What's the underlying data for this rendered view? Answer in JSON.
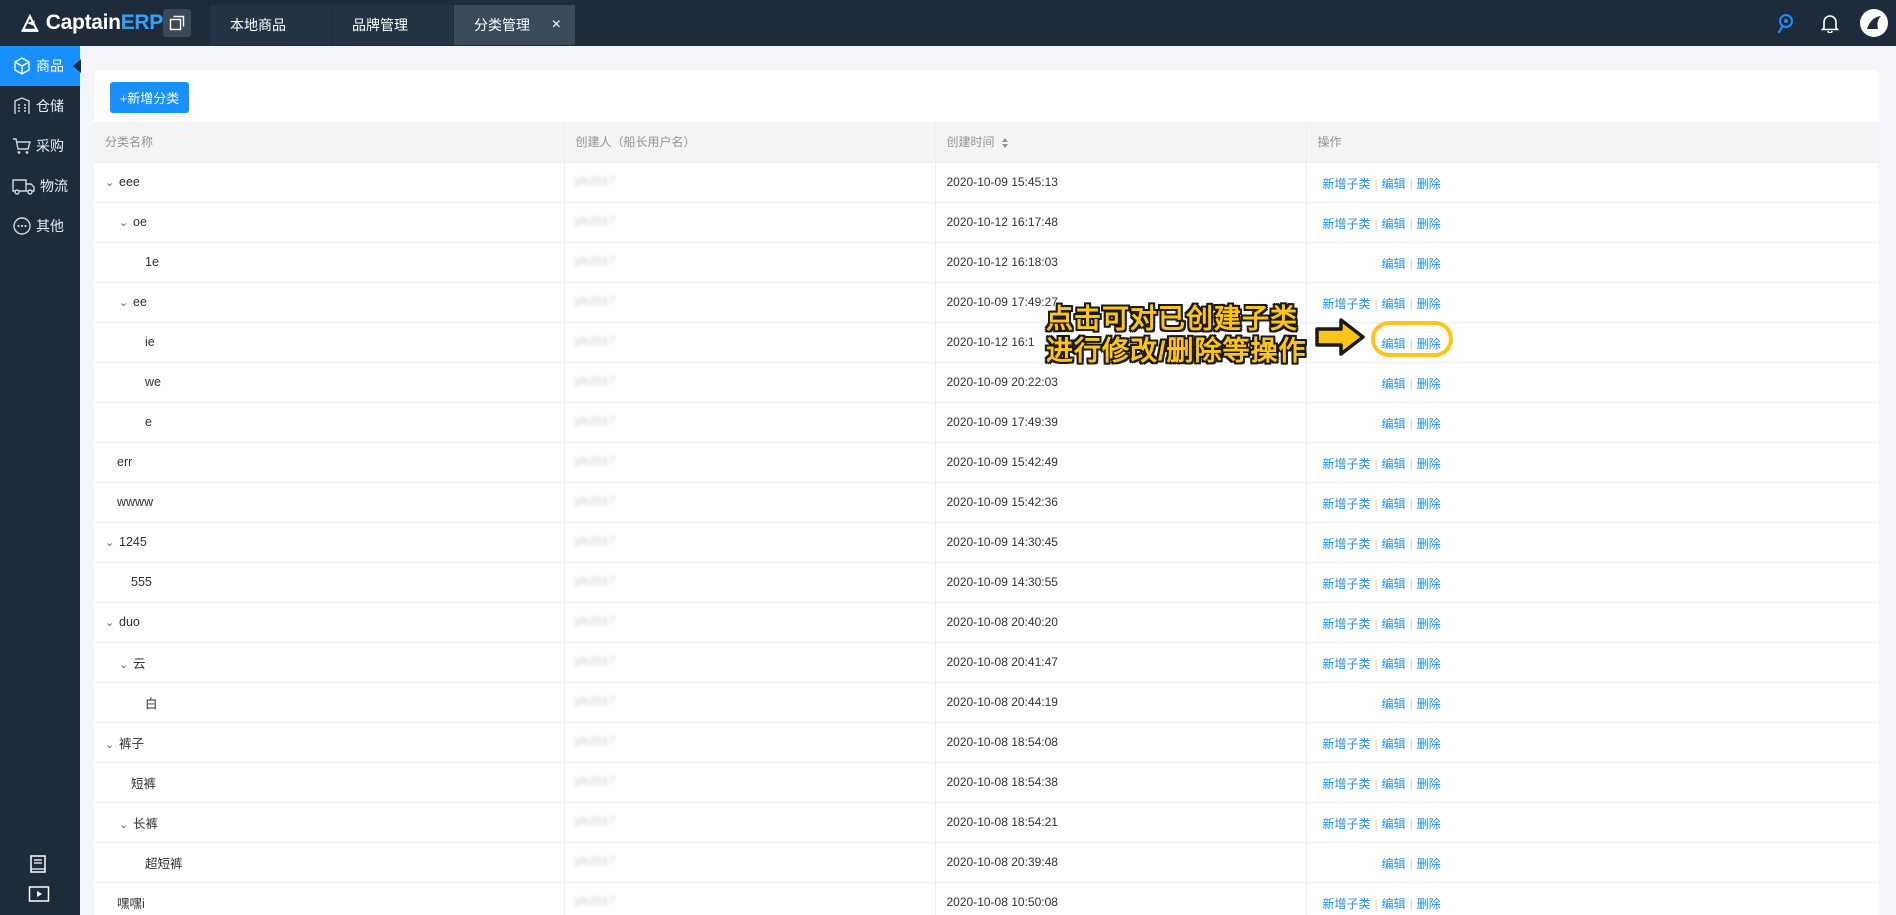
{
  "app": {
    "brand_main": "Captain",
    "brand_accent": "ERP"
  },
  "tabs": [
    {
      "label": "本地商品"
    },
    {
      "label": "品牌管理"
    },
    {
      "label": "分类管理",
      "closable": true
    }
  ],
  "sidebar": {
    "items": [
      {
        "label": "商品",
        "icon": "cube-icon",
        "active": true
      },
      {
        "label": "仓储",
        "icon": "warehouse-icon"
      },
      {
        "label": "采购",
        "icon": "cart-icon"
      },
      {
        "label": "物流",
        "icon": "truck-icon"
      },
      {
        "label": "其他",
        "icon": "more-icon"
      }
    ]
  },
  "main": {
    "add_button": "+新增分类",
    "columns": {
      "name": "分类名称",
      "creator": "创建人（船长用户名）",
      "time": "创建时间",
      "ops": "操作"
    },
    "op_labels": {
      "add_child": "新增子类",
      "edit": "编辑",
      "delete": "删除"
    },
    "rows": [
      {
        "name": "eee",
        "level": 0,
        "expandable": true,
        "creator": "jdu2017",
        "time": "2020-10-09 15:45:13",
        "can_add": true
      },
      {
        "name": "oe",
        "level": 1,
        "expandable": true,
        "creator": "jdu2017",
        "time": "2020-10-12 16:17:48",
        "can_add": true
      },
      {
        "name": "1e",
        "level": 2,
        "expandable": false,
        "creator": "jdu2017",
        "time": "2020-10-12 16:18:03",
        "can_add": false
      },
      {
        "name": "ee",
        "level": 1,
        "expandable": true,
        "creator": "jdu2017",
        "time": "2020-10-09 17:49:27",
        "can_add": true
      },
      {
        "name": "ie",
        "level": 2,
        "expandable": false,
        "creator": "jdu2017",
        "time": "2020-10-12 16:1",
        "can_add": false
      },
      {
        "name": "we",
        "level": 2,
        "expandable": false,
        "creator": "jdu2017",
        "time": "2020-10-09 20:22:03",
        "can_add": false
      },
      {
        "name": "e",
        "level": 2,
        "expandable": false,
        "creator": "jdu2017",
        "time": "2020-10-09 17:49:39",
        "can_add": false
      },
      {
        "name": "err",
        "level": 0,
        "expandable": false,
        "creator": "jdu2017",
        "time": "2020-10-09 15:42:49",
        "can_add": true
      },
      {
        "name": "wwww",
        "level": 0,
        "expandable": false,
        "creator": "jdu2017",
        "time": "2020-10-09 15:42:36",
        "can_add": true
      },
      {
        "name": "1245",
        "level": 0,
        "expandable": true,
        "creator": "jdu2017",
        "time": "2020-10-09 14:30:45",
        "can_add": true
      },
      {
        "name": "555",
        "level": 1,
        "expandable": false,
        "creator": "jdu2017",
        "time": "2020-10-09 14:30:55",
        "can_add": true
      },
      {
        "name": "duo",
        "level": 0,
        "expandable": true,
        "creator": "jdu2017",
        "time": "2020-10-08 20:40:20",
        "can_add": true
      },
      {
        "name": "云",
        "level": 1,
        "expandable": true,
        "creator": "jdu2017",
        "time": "2020-10-08 20:41:47",
        "can_add": true
      },
      {
        "name": "白",
        "level": 2,
        "expandable": false,
        "creator": "jdu2017",
        "time": "2020-10-08 20:44:19",
        "can_add": false
      },
      {
        "name": "裤子",
        "level": 0,
        "expandable": true,
        "creator": "jdu2017",
        "time": "2020-10-08 18:54:08",
        "can_add": true
      },
      {
        "name": "短裤",
        "level": 1,
        "expandable": false,
        "creator": "jdu2017",
        "time": "2020-10-08 18:54:38",
        "can_add": true
      },
      {
        "name": "长裤",
        "level": 1,
        "expandable": true,
        "creator": "jdu2017",
        "time": "2020-10-08 18:54:21",
        "can_add": true
      },
      {
        "name": "超短裤",
        "level": 2,
        "expandable": false,
        "creator": "jdu2017",
        "time": "2020-10-08 20:39:48",
        "can_add": false
      },
      {
        "name": "嘿嘿i",
        "level": 0,
        "expandable": false,
        "creator": "jdu2017",
        "time": "2020-10-08 10:50:08",
        "can_add": true
      }
    ]
  },
  "annotation": {
    "line1": "点击可对已创建子类",
    "line2": "进行修改/删除等操作"
  },
  "colors": {
    "accent": "#1890ff",
    "topbar": "#1d2b3a",
    "highlight": "#ffc41a"
  }
}
